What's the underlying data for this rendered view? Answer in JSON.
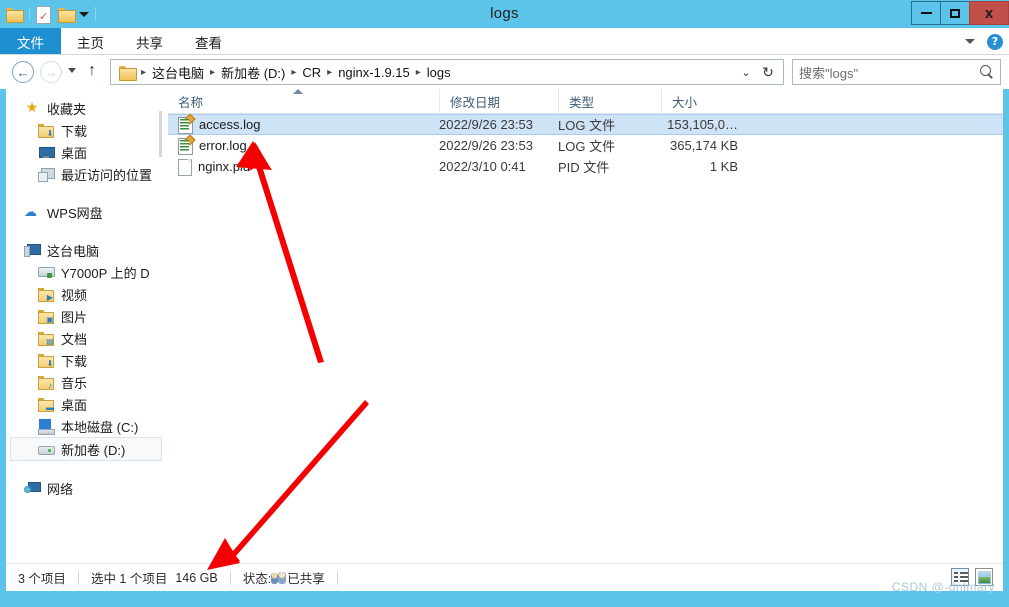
{
  "window": {
    "title": "logs",
    "quick_access": [
      "folder-icon",
      "properties-icon",
      "new-folder-icon",
      "dropdown-caret-icon"
    ],
    "controls": {
      "minimize": "–",
      "maximize": "❐",
      "close": "x"
    }
  },
  "ribbon": {
    "tabs": [
      {
        "label": "文件",
        "active": true
      },
      {
        "label": "主页",
        "active": false
      },
      {
        "label": "共享",
        "active": false
      },
      {
        "label": "查看",
        "active": false
      }
    ],
    "expand_caret": "chevron-down-icon",
    "help": "?"
  },
  "navigation": {
    "back": "←",
    "forward": "→",
    "recent_caret": "▾",
    "up": "↑",
    "breadcrumbs": [
      "这台电脑",
      "新加卷 (D:)",
      "CR",
      "nginx-1.9.15",
      "logs"
    ],
    "separator": "▸",
    "dropdown": "⌄",
    "refresh": "↻"
  },
  "search": {
    "placeholder": "搜索\"logs\"",
    "value": "",
    "icon": "search-icon"
  },
  "sidebar": {
    "groups": [
      {
        "header": {
          "label": "收藏夹",
          "icon": "star-icon"
        },
        "items": [
          {
            "label": "下载",
            "icon": "folder-download-icon"
          },
          {
            "label": "桌面",
            "icon": "desktop-icon"
          },
          {
            "label": "最近访问的位置",
            "icon": "recent-places-icon"
          }
        ]
      },
      {
        "header": {
          "label": "WPS网盘",
          "icon": "cloud-icon"
        },
        "items": []
      },
      {
        "header": {
          "label": "这台电脑",
          "icon": "computer-icon"
        },
        "items": [
          {
            "label": "Y7000P 上的 D",
            "icon": "remote-drive-icon"
          },
          {
            "label": "视频",
            "icon": "folder-video-icon"
          },
          {
            "label": "图片",
            "icon": "folder-pictures-icon"
          },
          {
            "label": "文档",
            "icon": "folder-documents-icon"
          },
          {
            "label": "下载",
            "icon": "folder-download-icon"
          },
          {
            "label": "音乐",
            "icon": "folder-music-icon"
          },
          {
            "label": "桌面",
            "icon": "folder-desktop-icon"
          },
          {
            "label": "本地磁盘 (C:)",
            "icon": "local-disk-icon"
          },
          {
            "label": "新加卷 (D:)",
            "icon": "drive-icon",
            "selected": true
          }
        ]
      },
      {
        "header": {
          "label": "网络",
          "icon": "network-icon"
        },
        "items": []
      }
    ]
  },
  "filelist": {
    "columns": [
      {
        "key": "name",
        "label": "名称",
        "sorted": "asc"
      },
      {
        "key": "date",
        "label": "修改日期"
      },
      {
        "key": "type",
        "label": "类型"
      },
      {
        "key": "size",
        "label": "大小"
      }
    ],
    "rows": [
      {
        "name": "access.log",
        "date": "2022/9/26 23:53",
        "type": "LOG 文件",
        "size": "153,105,0…",
        "icon": "log-file-icon",
        "selected": true
      },
      {
        "name": "error.log",
        "date": "2022/9/26 23:53",
        "type": "LOG 文件",
        "size": "365,174 KB",
        "icon": "log-file-icon",
        "selected": false
      },
      {
        "name": "nginx.pid",
        "date": "2022/3/10 0:41",
        "type": "PID 文件",
        "size": "1 KB",
        "icon": "pid-file-icon",
        "selected": false
      }
    ]
  },
  "statusbar": {
    "item_count": "3 个项目",
    "selection": "选中 1 个项目",
    "selection_size": "146 GB",
    "state_label": "状态:",
    "state_value": "已共享",
    "state_icon": "shared-users-icon",
    "view_details": "details-view-icon",
    "view_thumbnails": "thumbnail-view-icon"
  },
  "watermark": {
    "text": "CSDN @-dnlmary"
  },
  "colors": {
    "title_bar": "#5bc4e8",
    "file_tab": "#1e90d2",
    "selection": "#cfe3f7",
    "close_button": "#c1504a",
    "annotation_arrow": "#f50000"
  }
}
